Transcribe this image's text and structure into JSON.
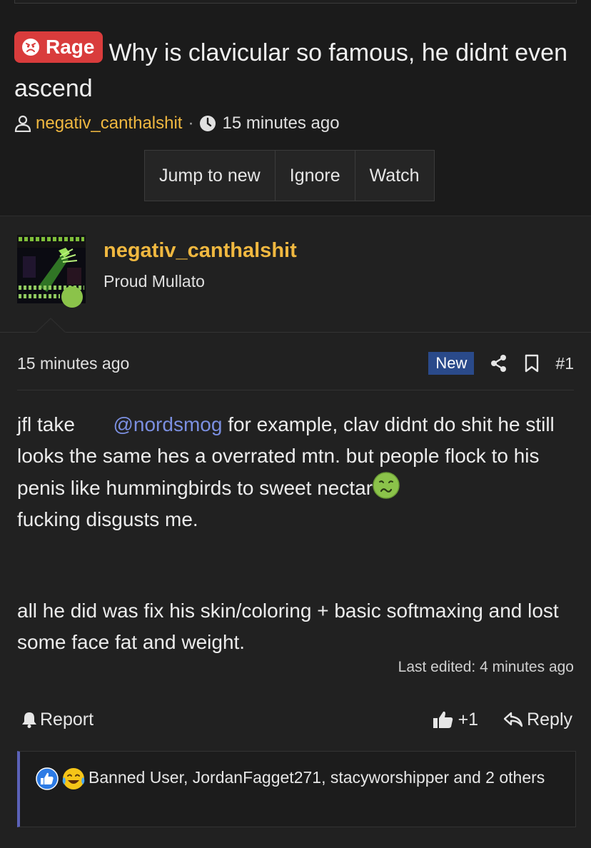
{
  "thread": {
    "prefix_label": "Rage",
    "title": "Why is clavicular so famous, he didnt even ascend",
    "author": "negativ_canthalshit",
    "separator": "·",
    "time": "15 minutes ago"
  },
  "thread_buttons": {
    "jump_to_new": "Jump to new",
    "ignore": "Ignore",
    "watch": "Watch"
  },
  "post": {
    "username": "negativ_canthalshit",
    "user_title": "Proud Mullato",
    "time": "15 minutes ago",
    "new_badge": "New",
    "post_number": "#1",
    "body": {
      "line1_prefix": "jfl take ",
      "mention": "@nordsmog",
      "line1_suffix": " for example, clav didnt do shit he still looks the same hes a overrated mtn. but people flock to his penis like hummingbirds to sweet nectar",
      "line1_end": "fucking disgusts me.",
      "para2": "all he did was fix his skin/coloring + basic softmaxing and lost some face fat and weight."
    },
    "last_edited": "Last edited: 4 minutes ago",
    "actions": {
      "report": "Report",
      "like_count": "+1",
      "reply": "Reply"
    },
    "reactions_text": "Banned User, JordanFagget271, stacyworshipper and 2 others"
  },
  "colors": {
    "accent_username": "#f0b840",
    "rage_badge": "#d93c3c",
    "mention": "#7b8fe0",
    "new_badge": "#2a4a8a",
    "online": "#8bc34a",
    "reactions_border": "#5b62b8"
  }
}
